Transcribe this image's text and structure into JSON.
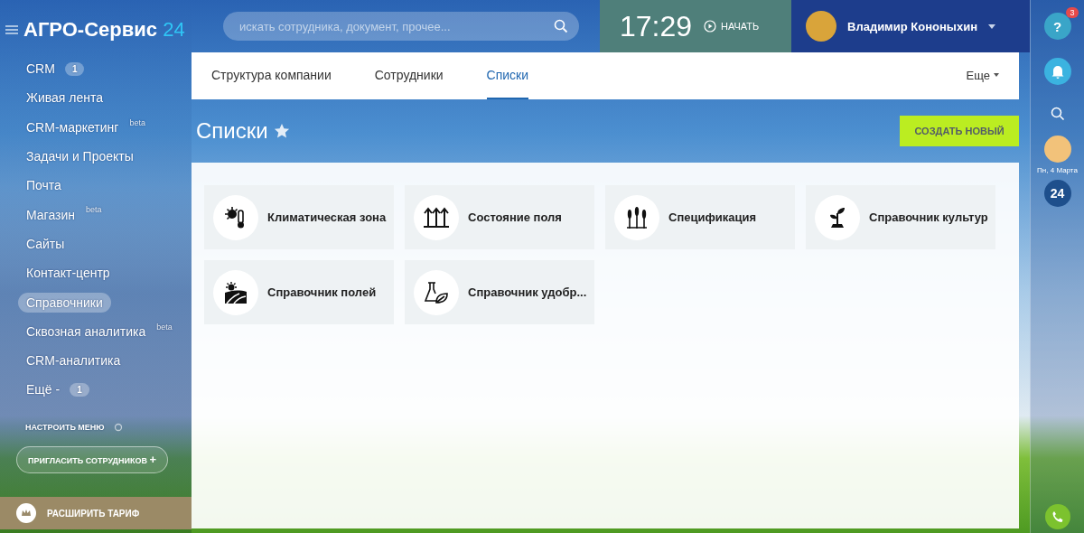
{
  "header": {
    "logo": "АГРО-Сервис",
    "logo_suffix": "24",
    "search": {
      "placeholder": "искать сотрудника, документ, прочее..."
    },
    "clock": "17:29",
    "start": "НАЧАТЬ",
    "user": "Владимир Кононыхин"
  },
  "sidebar": {
    "items": [
      {
        "label": "CRM",
        "badge": "1",
        "selected": false
      },
      {
        "label": "Живая лента",
        "selected": false
      },
      {
        "label": "CRM-маркетинг",
        "beta": "beta",
        "selected": false
      },
      {
        "label": "Задачи и Проекты",
        "selected": false
      },
      {
        "label": "Почта",
        "selected": false
      },
      {
        "label": "Магазин",
        "beta": "beta",
        "selected": false
      },
      {
        "label": "Сайты",
        "selected": false
      },
      {
        "label": "Контакт-центр",
        "selected": false
      },
      {
        "label": "Справочники",
        "selected": true
      },
      {
        "label": "Сквозная аналитика",
        "beta": "beta",
        "selected": false
      },
      {
        "label": "CRM-аналитика",
        "selected": false
      },
      {
        "label": "Ещё -",
        "badge": "1",
        "selected": false
      }
    ],
    "settings": "НАСТРОИТЬ МЕНЮ",
    "invite": "ПРИГЛАСИТЬ СОТРУДНИКОВ",
    "invite_plus": "+",
    "upgrade": "РАСШИРИТЬ ТАРИФ"
  },
  "tabs": [
    {
      "label": "Структура компании",
      "selected": false
    },
    {
      "label": "Сотрудники",
      "selected": false
    },
    {
      "label": "Списки",
      "selected": true
    }
  ],
  "more_tab": "Еще",
  "page_title": "Списки",
  "create_button": "СОЗДАТЬ НОВЫЙ",
  "lists": [
    {
      "label": "Климатическая зона",
      "kind": "climate"
    },
    {
      "label": "Состояние поля",
      "kind": "growth"
    },
    {
      "label": "Спецификация",
      "kind": "wheat"
    },
    {
      "label": "Справочник культур",
      "kind": "sprout"
    },
    {
      "label": "Справочник полей",
      "kind": "field"
    },
    {
      "label": "Справочник удобр...",
      "kind": "flask"
    }
  ],
  "right_bar": {
    "help": "?",
    "help_badge": "3",
    "date": "Пн, 4 Марта",
    "logo": "24"
  }
}
